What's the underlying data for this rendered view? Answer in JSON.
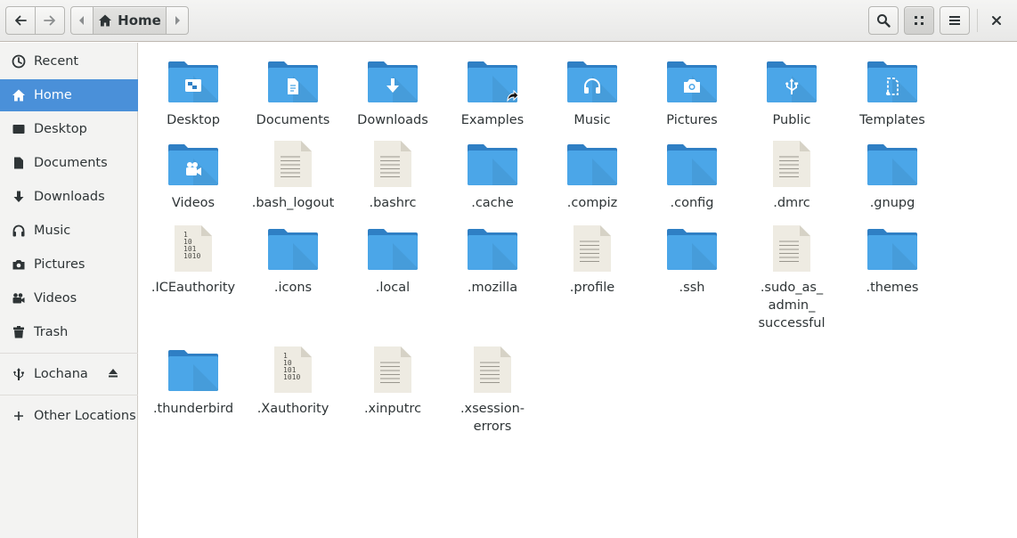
{
  "header": {
    "path_current": "Home"
  },
  "sidebar": {
    "items": [
      {
        "label": "Recent",
        "icon": "clock-icon"
      },
      {
        "label": "Home",
        "icon": "home-icon",
        "active": true
      },
      {
        "label": "Desktop",
        "icon": "desktop-icon"
      },
      {
        "label": "Documents",
        "icon": "document-icon"
      },
      {
        "label": "Downloads",
        "icon": "download-icon"
      },
      {
        "label": "Music",
        "icon": "headphones-icon"
      },
      {
        "label": "Pictures",
        "icon": "camera-icon"
      },
      {
        "label": "Videos",
        "icon": "video-camera-icon"
      },
      {
        "label": "Trash",
        "icon": "trash-icon"
      }
    ],
    "device": {
      "label": "Lochana",
      "icon": "usb-icon"
    },
    "other": {
      "label": "Other Locations",
      "icon": "plus-icon"
    }
  },
  "files": [
    {
      "name": "Desktop",
      "type": "folder",
      "glyph": "desktop"
    },
    {
      "name": "Documents",
      "type": "folder",
      "glyph": "document"
    },
    {
      "name": "Downloads",
      "type": "folder",
      "glyph": "download"
    },
    {
      "name": "Examples",
      "type": "folder",
      "glyph": "link"
    },
    {
      "name": "Music",
      "type": "folder",
      "glyph": "music"
    },
    {
      "name": "Pictures",
      "type": "folder",
      "glyph": "pictures"
    },
    {
      "name": "Public",
      "type": "folder",
      "glyph": "share"
    },
    {
      "name": "Templates",
      "type": "folder",
      "glyph": "templates"
    },
    {
      "name": "Videos",
      "type": "folder",
      "glyph": "video"
    },
    {
      "name": ".bash_logout",
      "type": "text"
    },
    {
      "name": ".bashrc",
      "type": "text"
    },
    {
      "name": ".cache",
      "type": "folder",
      "glyph": ""
    },
    {
      "name": ".compiz",
      "type": "folder",
      "glyph": ""
    },
    {
      "name": ".config",
      "type": "folder",
      "glyph": ""
    },
    {
      "name": ".dmrc",
      "type": "text"
    },
    {
      "name": ".gnupg",
      "type": "folder",
      "glyph": ""
    },
    {
      "name": ".ICEauthority",
      "type": "binary"
    },
    {
      "name": ".icons",
      "type": "folder",
      "glyph": ""
    },
    {
      "name": ".local",
      "type": "folder",
      "glyph": ""
    },
    {
      "name": ".mozilla",
      "type": "folder",
      "glyph": ""
    },
    {
      "name": ".profile",
      "type": "text"
    },
    {
      "name": ".ssh",
      "type": "folder",
      "glyph": ""
    },
    {
      "name": ".sudo_as_admin_successful",
      "display": ".sudo_as_\nadmin_\nsuccessful",
      "type": "text"
    },
    {
      "name": ".themes",
      "type": "folder",
      "glyph": ""
    },
    {
      "name": ".thunderbird",
      "type": "folder",
      "glyph": ""
    },
    {
      "name": ".Xauthority",
      "type": "binary"
    },
    {
      "name": ".xinputrc",
      "type": "text"
    },
    {
      "name": ".xsession-errors",
      "display": ".xsession-\nerrors",
      "type": "text"
    }
  ],
  "binary_glyph": [
    "1",
    "10",
    "101",
    "1010"
  ],
  "colors": {
    "accent": "#4a90d9",
    "folder_front": "#4ba6e8",
    "folder_back": "#2f7fc4",
    "doc_paper": "#eeebe2"
  }
}
